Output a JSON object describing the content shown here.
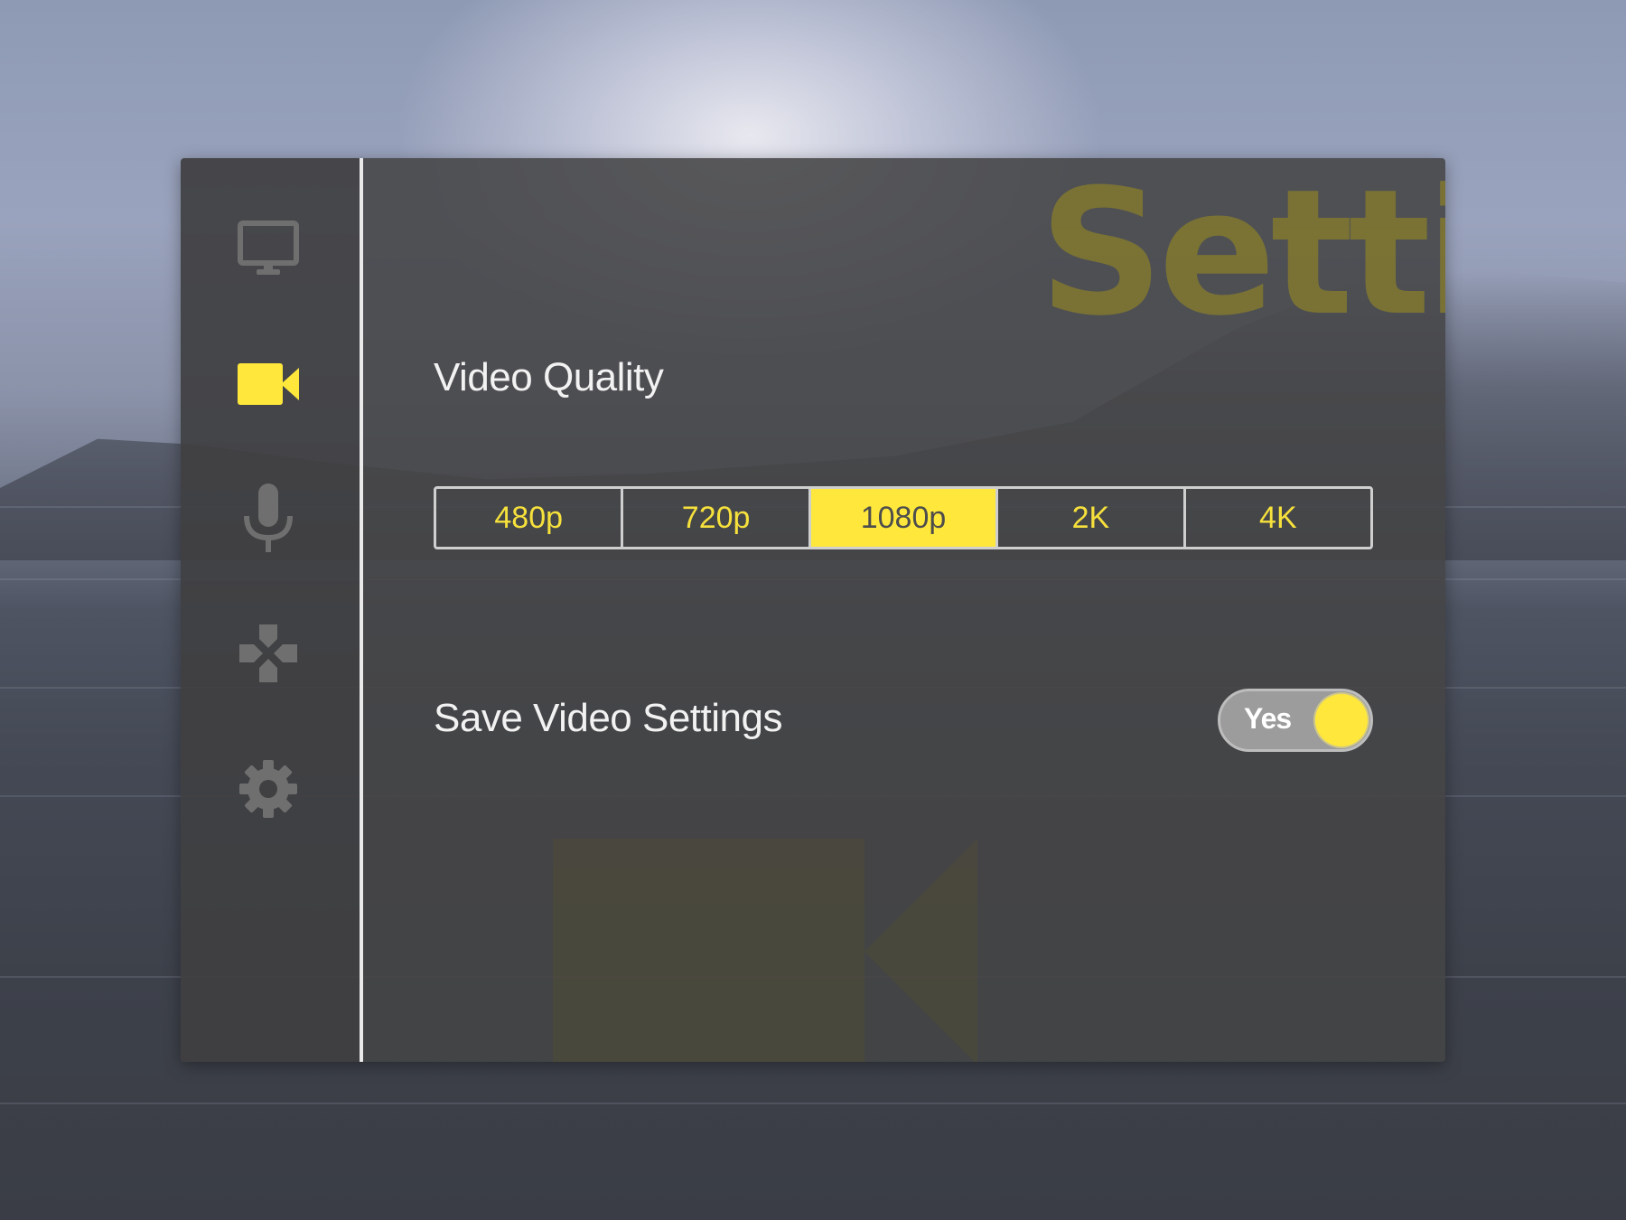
{
  "page": {
    "watermark_title": "Settings"
  },
  "sidebar": {
    "items": [
      {
        "icon": "monitor-icon",
        "active": false
      },
      {
        "icon": "video-camera-icon",
        "active": true
      },
      {
        "icon": "microphone-icon",
        "active": false
      },
      {
        "icon": "gamepad-icon",
        "active": false
      },
      {
        "icon": "gear-icon",
        "active": false
      }
    ]
  },
  "video_quality": {
    "label": "Video Quality",
    "options": [
      "480p",
      "720p",
      "1080p",
      "2K",
      "4K"
    ],
    "selected": "1080p"
  },
  "save_settings": {
    "label": "Save Video Settings",
    "toggle_label": "Yes",
    "value": true
  },
  "colors": {
    "accent": "#ffe83b",
    "panel": "#444446",
    "sidebar": "#404042",
    "inactive_icon": "#6f6f6f",
    "watermark": "#7e7632"
  }
}
